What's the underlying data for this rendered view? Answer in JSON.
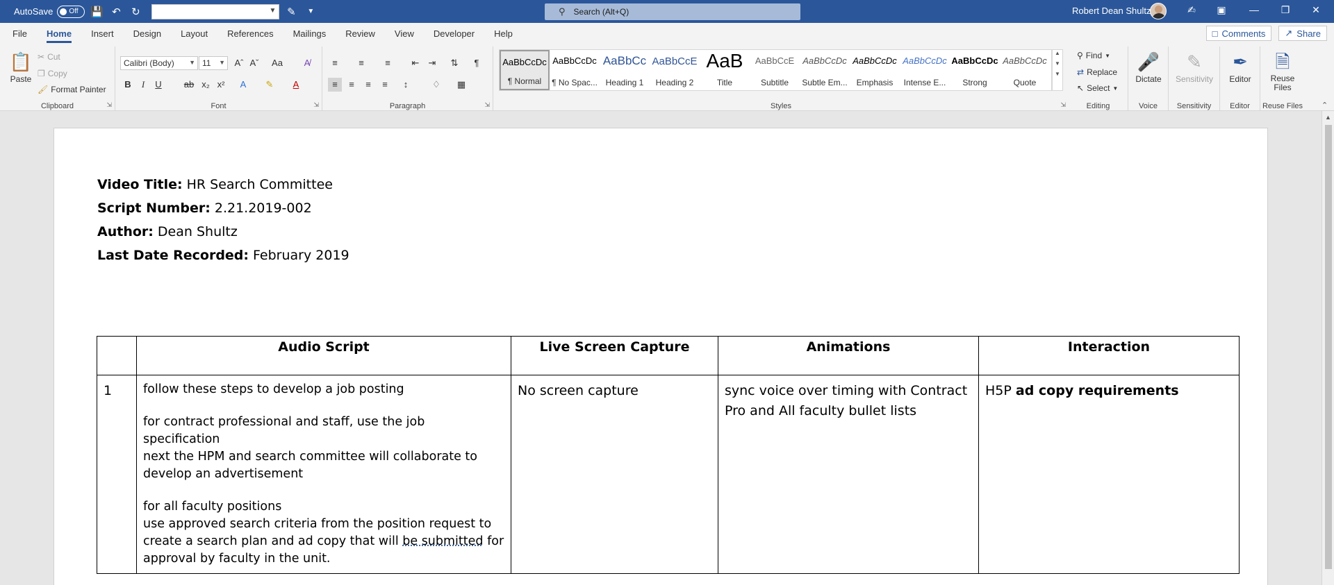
{
  "titlebar": {
    "autosave_label": "AutoSave",
    "autosave_state": "Off",
    "search_placeholder": "Search (Alt+Q)",
    "user_name": "Robert Dean Shultz"
  },
  "menu": {
    "tabs": [
      "File",
      "Home",
      "Insert",
      "Design",
      "Layout",
      "References",
      "Mailings",
      "Review",
      "View",
      "Developer",
      "Help"
    ],
    "active": "Home",
    "comments_label": "Comments",
    "share_label": "Share"
  },
  "ribbon": {
    "clipboard": {
      "paste": "Paste",
      "cut": "Cut",
      "copy": "Copy",
      "format_painter": "Format Painter",
      "label": "Clipboard"
    },
    "font": {
      "family": "Calibri (Body)",
      "size": "11",
      "case_btn": "Aa",
      "label": "Font"
    },
    "paragraph": {
      "label": "Paragraph"
    },
    "styles": {
      "items": [
        {
          "sample": "AaBbCcDc",
          "name": "¶ Normal"
        },
        {
          "sample": "AaBbCcDc",
          "name": "¶ No Spac..."
        },
        {
          "sample": "AaBbCc",
          "name": "Heading 1"
        },
        {
          "sample": "AaBbCcE",
          "name": "Heading 2"
        },
        {
          "sample": "AaB",
          "name": "Title"
        },
        {
          "sample": "AaBbCcE",
          "name": "Subtitle"
        },
        {
          "sample": "AaBbCcDc",
          "name": "Subtle Em..."
        },
        {
          "sample": "AaBbCcDc",
          "name": "Emphasis"
        },
        {
          "sample": "AaBbCcDc",
          "name": "Intense E..."
        },
        {
          "sample": "AaBbCcDc",
          "name": "Strong"
        },
        {
          "sample": "AaBbCcDc",
          "name": "Quote"
        }
      ],
      "label": "Styles"
    },
    "editing": {
      "find": "Find",
      "replace": "Replace",
      "select": "Select",
      "label": "Editing"
    },
    "voice": {
      "dictate": "Dictate",
      "label": "Voice"
    },
    "sensitivity": {
      "button": "Sensitivity",
      "label": "Sensitivity"
    },
    "editor": {
      "button": "Editor",
      "label": "Editor"
    },
    "reuse": {
      "button_line1": "Reuse",
      "button_line2": "Files",
      "label": "Reuse Files"
    }
  },
  "document": {
    "meta": [
      {
        "key": "Video Title:",
        "value": "HR Search Committee"
      },
      {
        "key": "Script Number:",
        "value": "2.21.2019-002"
      },
      {
        "key": "Author:",
        "value": "Dean Shultz"
      },
      {
        "key": "Last Date Recorded:",
        "value": "February 2019"
      }
    ],
    "table": {
      "headers": [
        "",
        "Audio Script",
        "Live Screen Capture",
        "Animations",
        "Interaction"
      ],
      "row": {
        "num": "1",
        "audio": {
          "p1": "follow these steps to develop a job posting",
          "p2": "for contract professional and staff, use the job specification",
          "p3": "next the HPM and search committee will collaborate to develop an advertisement",
          "p4": "for all faculty positions",
          "p5_pre": "use approved search criteria from the position request to create a search plan and ad copy that will ",
          "p5_flag": "be submitted",
          "p5_post": " for approval by faculty in the unit."
        },
        "live": "No screen capture",
        "animations": "sync voice over timing with Contract Pro and All faculty bullet lists",
        "interaction_pre": "H5P ",
        "interaction_bold": "ad copy requirements"
      }
    }
  }
}
